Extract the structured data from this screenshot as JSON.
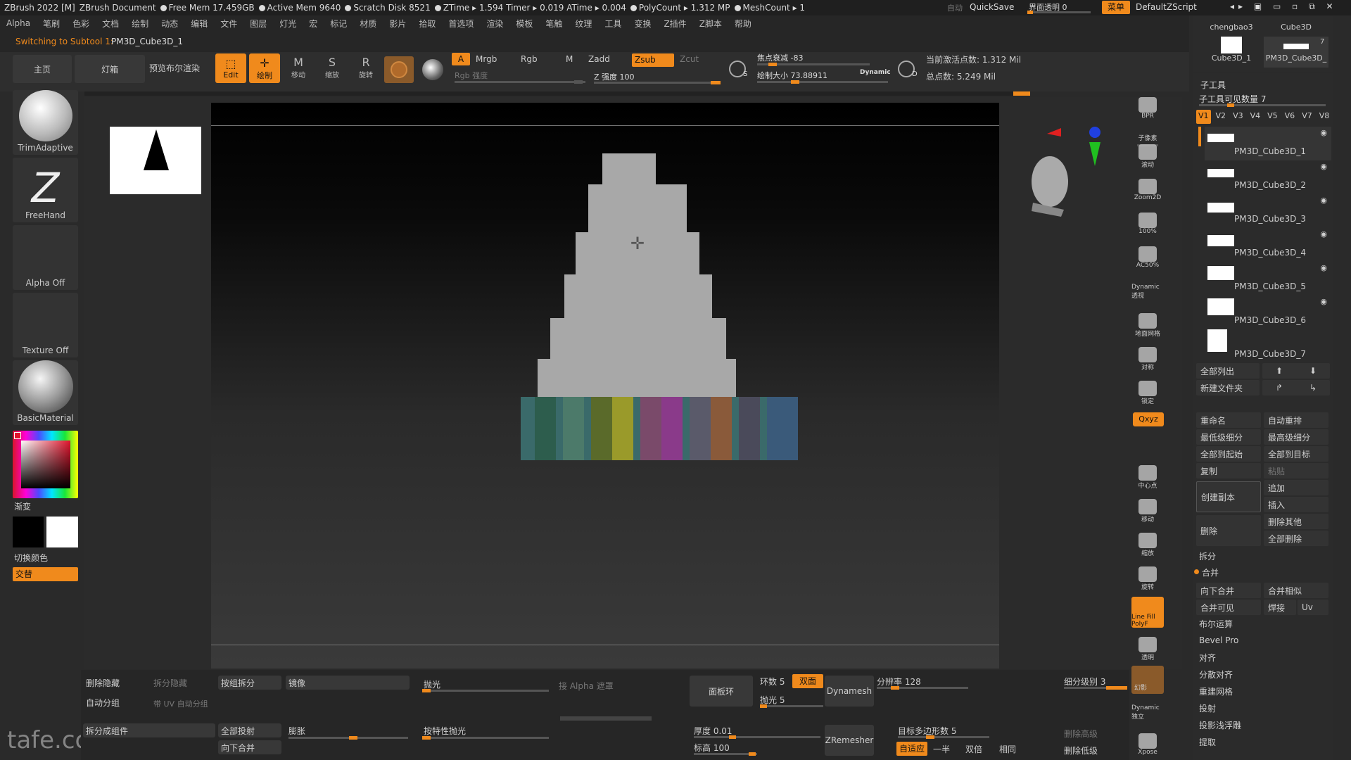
{
  "titlebar": {
    "app": "ZBrush 2022 [M]",
    "doc": "ZBrush Document",
    "free_mem": "Free Mem 17.459GB",
    "active_mem": "Active Mem 9640",
    "scratch": "Scratch Disk 8521",
    "ztime": "ZTime ▸ 1.594 Timer ▸ 0.019 ATime ▸ 0.004",
    "polycount": "PolyCount ▸ 1.312 MP",
    "meshcount": "MeshCount ▸ 1",
    "auto": "自动",
    "quicksave": "QuickSave",
    "transparency": "界面透明 0",
    "menu": "菜单",
    "script": "DefaultZScript"
  },
  "menubar": [
    "Alpha",
    "笔刷",
    "色彩",
    "文档",
    "绘制",
    "动态",
    "编辑",
    "文件",
    "图层",
    "灯光",
    "宏",
    "标记",
    "材质",
    "影片",
    "拾取",
    "首选项",
    "渲染",
    "模板",
    "笔触",
    "纹理",
    "工具",
    "变换",
    "Z插件",
    "Z脚本",
    "帮助"
  ],
  "status_msg": "Switching to Subtool 1:",
  "status_subtool": "PM3D_Cube3D_1",
  "toolbar": {
    "home": "主页",
    "lightbox": "灯箱",
    "preview": "预览布尔渲染",
    "edit": "Edit",
    "draw": "绘制",
    "move": "移动",
    "scale": "缩放",
    "rotate": "旋转",
    "a": "A",
    "mrgb": "Mrgb",
    "rgb": "Rgb",
    "m": "M",
    "zadd": "Zadd",
    "zsub": "Zsub",
    "zcut": "Zcut",
    "rgb_intensity": "Rgb 强度",
    "z_intensity": "Z 强度 100",
    "focal": "焦点衰减 -83",
    "draw_size": "绘制大小 73.88911",
    "dynamic": "Dynamic",
    "active_points": "当前激活点数: 1.312 Mil",
    "total_points": "总点数: 5.249 Mil",
    "s": "S",
    "d": "D"
  },
  "left": {
    "brush1": "TrimAdaptive",
    "brush2": "FreeHand",
    "alpha": "Alpha Off",
    "texture": "Texture Off",
    "material": "BasicMaterial",
    "gradient": "渐变",
    "switch_color": "切换颜色",
    "alternate": "交替"
  },
  "right_icons": [
    "BPR",
    "子像素",
    "滚动",
    "Zoom2D",
    "100%",
    "AC50%",
    "Dynamic 透视",
    "地面网格",
    "对称",
    "锁定",
    "Qxyz",
    "中心点",
    "移动",
    "缩放",
    "旋转",
    "Line Fill PolyF",
    "透明",
    "幻影",
    "Dynamic 独立",
    "Xpose"
  ],
  "toolthumbs": {
    "t1": "chengbao3",
    "t2": "Cube3D",
    "t3": "Cube3D_1",
    "t4": "PM3D_Cube3D_",
    "count": "7"
  },
  "subtool": {
    "title": "子工具",
    "visible": "子工具可见数量 7",
    "versions": [
      "V1",
      "V2",
      "V3",
      "V4",
      "V5",
      "V6",
      "V7",
      "V8"
    ],
    "items": [
      "PM3D_Cube3D_1",
      "PM3D_Cube3D_2",
      "PM3D_Cube3D_3",
      "PM3D_Cube3D_4",
      "PM3D_Cube3D_5",
      "PM3D_Cube3D_6",
      "PM3D_Cube3D_7"
    ],
    "list_all": "全部列出",
    "new_folder": "新建文件夹",
    "rename": "重命名",
    "auto_reorder": "自动重排",
    "lowest_sub": "最低级细分",
    "highest_sub": "最高级细分",
    "all_to_start": "全部到起始",
    "all_to_target": "全部到目标",
    "copy": "复制",
    "paste": "粘贴",
    "duplicate": "创建副本",
    "append": "追加",
    "insert": "插入",
    "delete": "删除",
    "delete_other": "删除其他",
    "delete_all": "全部删除",
    "split": "拆分",
    "merge": "合并",
    "merge_down": "向下合并",
    "merge_similar": "合并相似",
    "merge_visible": "合并可见",
    "weld": "焊接",
    "uv": "Uv",
    "boolean": "布尔运算",
    "bevel": "Bevel Pro",
    "align": "对齐",
    "distribute": "分散对齐",
    "remesh": "重建网格",
    "project": "投射",
    "project_bas": "投影浅浮雕",
    "extract": "提取"
  },
  "bottom": {
    "del_hidden": "删除隐藏",
    "split_hidden": "拆分隐藏",
    "groups_split": "按组拆分",
    "mirror": "镜像",
    "polish": "抛光",
    "by_alpha": "接 Alpha 遮罩",
    "auto_group": "自动分组",
    "uv_group": "带 UV 自动分组",
    "split_parts": "拆分成组件",
    "project_all": "全部投射",
    "inflate": "膨胀",
    "polish_feat": "按特性抛光",
    "merge_down": "向下合并",
    "panel_loops": "面板环",
    "loops": "环数 5",
    "double": "双面",
    "polish2": "抛光 5",
    "thickness": "厚度 0.01",
    "elevation": "标高 100",
    "dynamesh": "Dynamesh",
    "resolution": "分辨率 128",
    "zremesher": "ZRemesher",
    "target_poly": "目标多边形数 5",
    "adapt": "自适应",
    "half": "一半",
    "same": "双倍",
    "equal": "相同",
    "subdiv_level": "细分级别 3",
    "del_higher": "删除高级",
    "del_lower": "删除低级"
  },
  "watermark": "tafe.cc",
  "colors": {
    "accent": "#f08a1c",
    "bg": "#2a2a2a",
    "canvas": "#000000"
  }
}
